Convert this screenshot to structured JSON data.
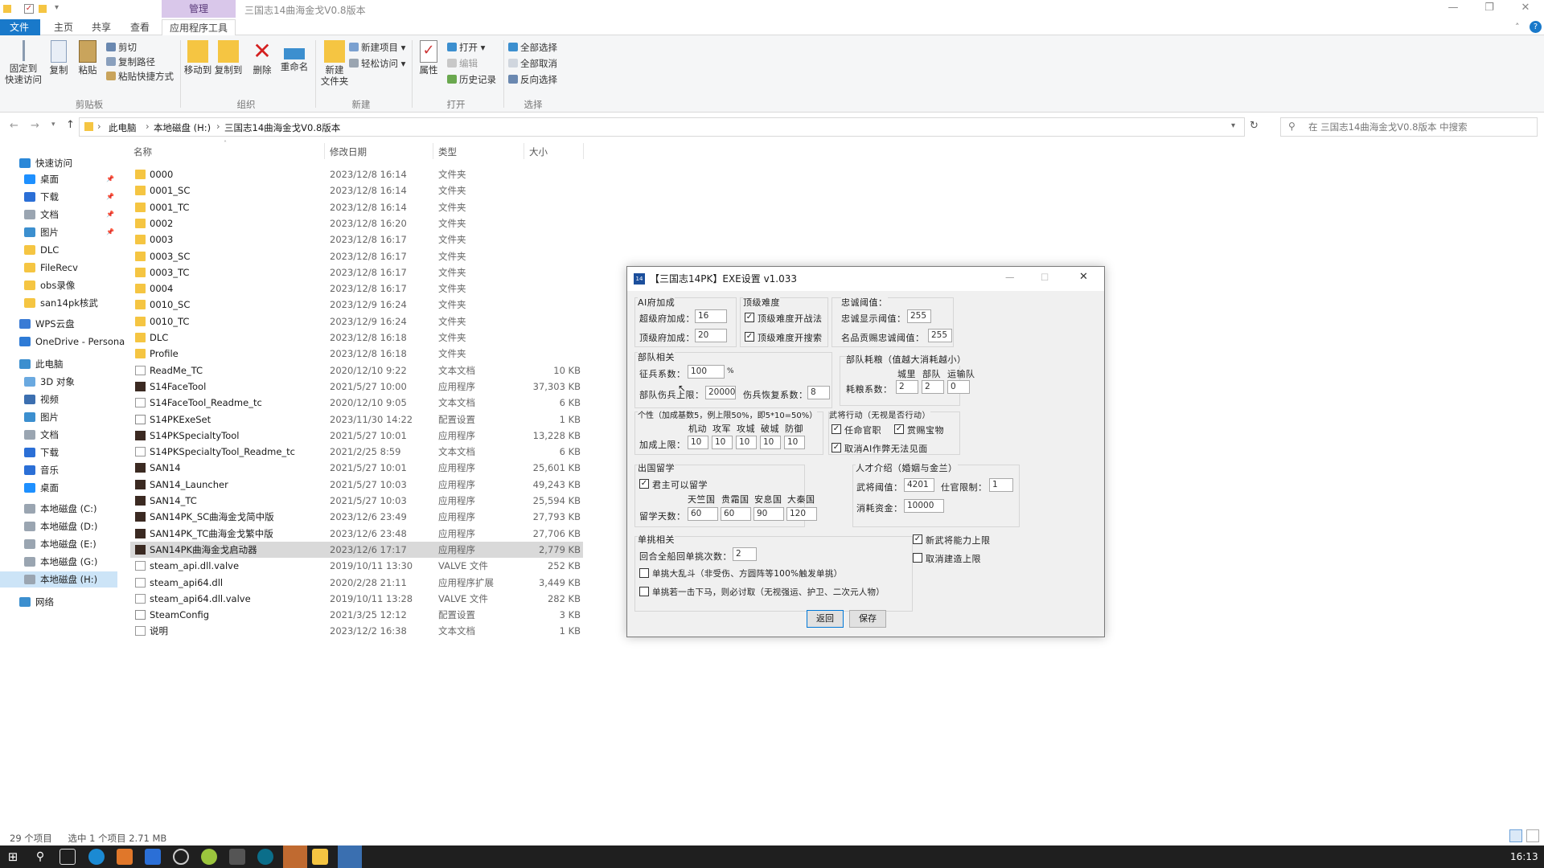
{
  "window": {
    "title": "三国志14曲海金戈V0.8版本",
    "context_tab": "管理",
    "min": "—",
    "max": "❐",
    "close": "✕"
  },
  "tabs": [
    "文件",
    "主页",
    "共享",
    "查看",
    "应用程序工具"
  ],
  "ribbon": {
    "pin": "固定到\n快速访问",
    "copy": "复制",
    "paste": "粘贴",
    "cut": "剪切",
    "copy_path": "复制路径",
    "paste_shortcut": "粘贴快捷方式",
    "move_to": "移动到",
    "copy_to": "复制到",
    "delete": "删除",
    "rename": "重命名",
    "new_folder": "新建\n文件夹",
    "new_item": "新建项目 ▾",
    "easy_access": "轻松访问 ▾",
    "properties": "属性",
    "open": "打开 ▾",
    "edit": "编辑",
    "history": "历史记录",
    "select_all": "全部选择",
    "select_none": "全部取消",
    "invert": "反向选择",
    "groups": [
      "剪贴板",
      "组织",
      "新建",
      "打开",
      "选择"
    ]
  },
  "address": {
    "crumbs": [
      "此电脑",
      "本地磁盘 (H:)",
      "三国志14曲海金戈V0.8版本"
    ],
    "search_placeholder": "在 三国志14曲海金戈V0.8版本 中搜索"
  },
  "nav": [
    {
      "label": "快速访问",
      "color": "#2b88d8"
    },
    {
      "label": "桌面",
      "color": "#1e90ff",
      "pin": "📌"
    },
    {
      "label": "下载",
      "color": "#2b6fd6",
      "pin": "📌"
    },
    {
      "label": "文档",
      "color": "#9aa5b1",
      "pin": "📌"
    },
    {
      "label": "图片",
      "color": "#3c8fcf",
      "pin": "📌"
    },
    {
      "label": "DLC",
      "color": "#f5c542"
    },
    {
      "label": "FileRecv",
      "color": "#f5c542"
    },
    {
      "label": "obs录像",
      "color": "#f5c542"
    },
    {
      "label": "san14pk核武",
      "color": "#f5c542"
    },
    {
      "label": "WPS云盘",
      "color": "#3a7bd5"
    },
    {
      "label": "OneDrive - Persona",
      "color": "#2e7bd6"
    },
    {
      "label": "此电脑",
      "color": "#3c8fcf"
    },
    {
      "label": "3D 对象",
      "color": "#6aa9e0"
    },
    {
      "label": "视频",
      "color": "#3c6fb0"
    },
    {
      "label": "图片",
      "color": "#3c8fcf"
    },
    {
      "label": "文档",
      "color": "#9aa5b1"
    },
    {
      "label": "下载",
      "color": "#2b6fd6"
    },
    {
      "label": "音乐",
      "color": "#2b6fd6"
    },
    {
      "label": "桌面",
      "color": "#1e90ff"
    },
    {
      "label": "本地磁盘 (C:)",
      "color": "#9aa5b1"
    },
    {
      "label": "本地磁盘 (D:)",
      "color": "#9aa5b1"
    },
    {
      "label": "本地磁盘 (E:)",
      "color": "#9aa5b1"
    },
    {
      "label": "本地磁盘 (G:)",
      "color": "#9aa5b1"
    },
    {
      "label": "本地磁盘 (H:)",
      "color": "#9aa5b1"
    },
    {
      "label": "网络",
      "color": "#3c8fcf"
    }
  ],
  "columns": [
    "名称",
    "修改日期",
    "类型",
    "大小"
  ],
  "files": [
    {
      "name": "0000",
      "date": "2023/12/8 16:14",
      "type": "文件夹",
      "size": "",
      "kind": "fold"
    },
    {
      "name": "0001_SC",
      "date": "2023/12/8 16:14",
      "type": "文件夹",
      "size": "",
      "kind": "fold"
    },
    {
      "name": "0001_TC",
      "date": "2023/12/8 16:14",
      "type": "文件夹",
      "size": "",
      "kind": "fold"
    },
    {
      "name": "0002",
      "date": "2023/12/8 16:20",
      "type": "文件夹",
      "size": "",
      "kind": "fold"
    },
    {
      "name": "0003",
      "date": "2023/12/8 16:17",
      "type": "文件夹",
      "size": "",
      "kind": "fold"
    },
    {
      "name": "0003_SC",
      "date": "2023/12/8 16:17",
      "type": "文件夹",
      "size": "",
      "kind": "fold"
    },
    {
      "name": "0003_TC",
      "date": "2023/12/8 16:17",
      "type": "文件夹",
      "size": "",
      "kind": "fold"
    },
    {
      "name": "0004",
      "date": "2023/12/8 16:17",
      "type": "文件夹",
      "size": "",
      "kind": "fold"
    },
    {
      "name": "0010_SC",
      "date": "2023/12/9 16:24",
      "type": "文件夹",
      "size": "",
      "kind": "fold"
    },
    {
      "name": "0010_TC",
      "date": "2023/12/9 16:24",
      "type": "文件夹",
      "size": "",
      "kind": "fold"
    },
    {
      "name": "DLC",
      "date": "2023/12/8 16:18",
      "type": "文件夹",
      "size": "",
      "kind": "fold"
    },
    {
      "name": "Profile",
      "date": "2023/12/8 16:18",
      "type": "文件夹",
      "size": "",
      "kind": "fold"
    },
    {
      "name": "ReadMe_TC",
      "date": "2020/12/10 9:22",
      "type": "文本文档",
      "size": "10 KB",
      "kind": "doc"
    },
    {
      "name": "S14FaceTool",
      "date": "2021/5/27 10:00",
      "type": "应用程序",
      "size": "37,303 KB",
      "kind": "app"
    },
    {
      "name": "S14FaceTool_Readme_tc",
      "date": "2020/12/10 9:05",
      "type": "文本文档",
      "size": "6 KB",
      "kind": "doc"
    },
    {
      "name": "S14PKExeSet",
      "date": "2023/11/30 14:22",
      "type": "配置设置",
      "size": "1 KB",
      "kind": "cfg"
    },
    {
      "name": "S14PKSpecialtyTool",
      "date": "2021/5/27 10:01",
      "type": "应用程序",
      "size": "13,228 KB",
      "kind": "app"
    },
    {
      "name": "S14PKSpecialtyTool_Readme_tc",
      "date": "2021/2/25 8:59",
      "type": "文本文档",
      "size": "6 KB",
      "kind": "doc"
    },
    {
      "name": "SAN14",
      "date": "2021/5/27 10:01",
      "type": "应用程序",
      "size": "25,601 KB",
      "kind": "app"
    },
    {
      "name": "SAN14_Launcher",
      "date": "2021/5/27 10:03",
      "type": "应用程序",
      "size": "49,243 KB",
      "kind": "app"
    },
    {
      "name": "SAN14_TC",
      "date": "2021/5/27 10:03",
      "type": "应用程序",
      "size": "25,594 KB",
      "kind": "app"
    },
    {
      "name": "SAN14PK_SC曲海金戈简中版",
      "date": "2023/12/6 23:49",
      "type": "应用程序",
      "size": "27,793 KB",
      "kind": "app"
    },
    {
      "name": "SAN14PK_TC曲海金戈繁中版",
      "date": "2023/12/6 23:48",
      "type": "应用程序",
      "size": "27,706 KB",
      "kind": "app"
    },
    {
      "name": "SAN14PK曲海金戈启动器",
      "date": "2023/12/6 17:17",
      "type": "应用程序",
      "size": "2,779 KB",
      "kind": "app",
      "selected": true
    },
    {
      "name": "steam_api.dll.valve",
      "date": "2019/10/11 13:30",
      "type": "VALVE 文件",
      "size": "252 KB",
      "kind": "doc"
    },
    {
      "name": "steam_api64.dll",
      "date": "2020/2/28 21:11",
      "type": "应用程序扩展",
      "size": "3,449 KB",
      "kind": "doc"
    },
    {
      "name": "steam_api64.dll.valve",
      "date": "2019/10/11 13:28",
      "type": "VALVE 文件",
      "size": "282 KB",
      "kind": "doc"
    },
    {
      "name": "SteamConfig",
      "date": "2021/3/25 12:12",
      "type": "配置设置",
      "size": "3 KB",
      "kind": "cfg"
    },
    {
      "name": "说明",
      "date": "2023/12/2 16:38",
      "type": "文本文档",
      "size": "1 KB",
      "kind": "doc"
    }
  ],
  "status": {
    "count": "29 个项目",
    "selected": "选中 1 个项目  2.71 MB"
  },
  "clock": "16:13",
  "dialog": {
    "title": "【三国志14PK】EXE设置 v1.033",
    "ai_group": "AI府加成",
    "super_label": "超级府加成：",
    "super_val": "16",
    "top_label": "顶级府加成：",
    "top_val": "20",
    "diff_group": "顶级难度",
    "diff_tactic": "顶级难度开战法",
    "diff_search": "顶级难度开搜索",
    "loyal_group": "忠诚阈值：",
    "loyal_show": "忠诚显示阈值：",
    "loyal_show_val": "255",
    "loyal_name": "名品贡赐忠诚阈值：",
    "loyal_name_val": "255",
    "unit_group": "部队相关",
    "conscript": "征兵系数：",
    "conscript_val": "100",
    "pct": "%",
    "wound_cap": "部队伤兵上限：",
    "wound_cap_val": "20000",
    "wound_rec": "伤兵恢复系数：",
    "wound_rec_val": "8",
    "cons_group": "部队耗粮（值越大消耗越小）",
    "cons_cols": [
      "城里",
      "部队",
      "运输队"
    ],
    "cons_label": "耗粮系数：",
    "cons_vals": [
      "2",
      "2",
      "0"
    ],
    "pers_group": "个性（加成基数5，例上限50%，即5*10=50%）",
    "pers_cols": [
      "机动",
      "攻军",
      "攻城",
      "破城",
      "防御"
    ],
    "pers_label": "加成上限：",
    "pers_vals": [
      "10",
      "10",
      "10",
      "10",
      "10"
    ],
    "gen_group": "武将行动（无视是否行动）",
    "gen_appoint": "任命官职",
    "gen_gift": "赏赐宝物",
    "gen_cancel_ai": "取消AI作弊无法见面",
    "study_group": "出国留学",
    "study_lord": "君主可以留学",
    "study_cols": [
      "天竺国",
      "贵霜国",
      "安息国",
      "大秦国"
    ],
    "study_label": "留学天数：",
    "study_vals": [
      "60",
      "60",
      "90",
      "120"
    ],
    "talent_group": "人才介绍（婚姻与金兰）",
    "talent_gen": "武将阈值：",
    "talent_gen_val": "4201",
    "talent_office": "仕官限制：",
    "talent_office_val": "1",
    "talent_fund": "消耗资金：",
    "talent_fund_val": "10000",
    "duel_group": "单挑相关",
    "duel_rounds": "回合全船回单挑次数：",
    "duel_rounds_val": "2",
    "duel_chaos": "单挑大乱斗（非受伤、方圆阵等100%触发单挑）",
    "duel_horse": "单挑若一击下马，则必讨取（无视强运、护卫、二次元人物）",
    "new_gen": "新武将能力上限",
    "cancel_build": "取消建造上限",
    "btn_back": "返回",
    "btn_save": "保存"
  }
}
